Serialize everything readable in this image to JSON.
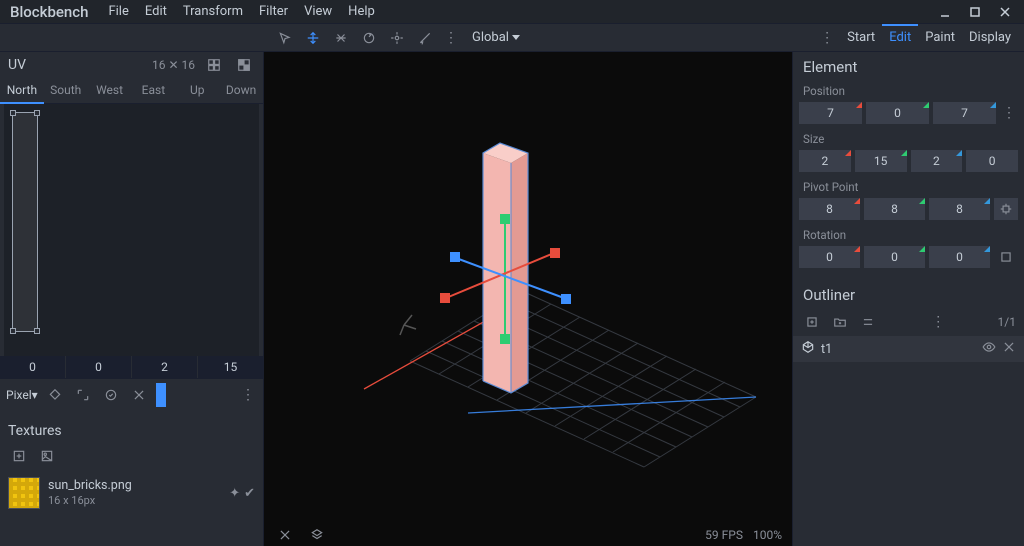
{
  "app": {
    "title": "Blockbench",
    "menus": [
      "File",
      "Edit",
      "Transform",
      "Filter",
      "View",
      "Help"
    ]
  },
  "toolbar": {
    "coordinate_space": "Global"
  },
  "mode_tabs": [
    "Start",
    "Edit",
    "Paint",
    "Display"
  ],
  "mode_active": "Edit",
  "uv": {
    "title": "UV",
    "resolution": "16 ✕ 16",
    "faces": [
      "North",
      "South",
      "West",
      "East",
      "Up",
      "Down"
    ],
    "face_active": "North",
    "values": [
      "0",
      "0",
      "2",
      "15"
    ],
    "pixel_label": "Pixel▾"
  },
  "textures": {
    "title": "Textures",
    "items": [
      {
        "name": "sun_bricks.png",
        "dim": "16 x 16px"
      }
    ]
  },
  "viewport": {
    "fps": "59 FPS",
    "zoom": "100%"
  },
  "element": {
    "title": "Element",
    "position_label": "Position",
    "position": [
      "7",
      "0",
      "7"
    ],
    "size_label": "Size",
    "size": [
      "2",
      "15",
      "2",
      "0"
    ],
    "pivot_label": "Pivot Point",
    "pivot": [
      "8",
      "8",
      "8"
    ],
    "rotation_label": "Rotation",
    "rotation": [
      "0",
      "0",
      "0"
    ]
  },
  "outliner": {
    "title": "Outliner",
    "count": "1/1",
    "items": [
      {
        "name": "t1"
      }
    ]
  }
}
